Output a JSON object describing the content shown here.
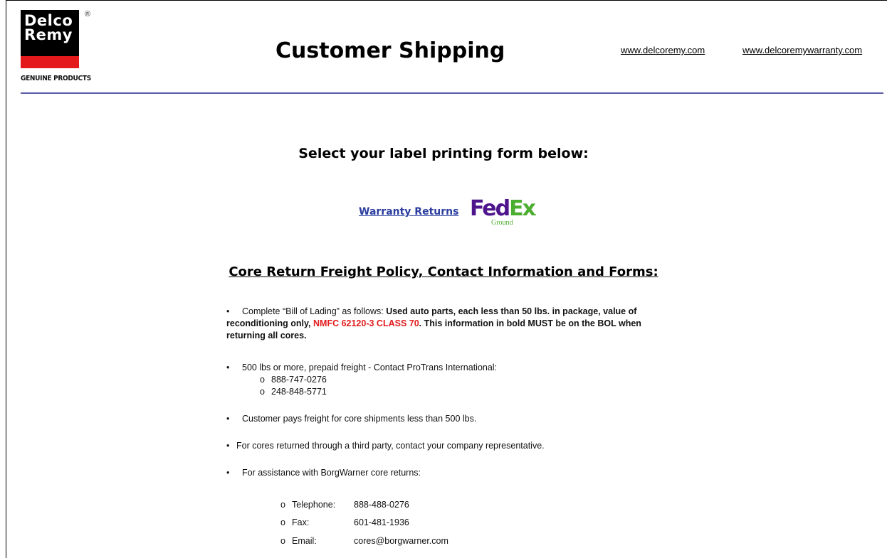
{
  "brand": {
    "line1": "Delco",
    "line2": "Remy",
    "registered": "®",
    "tagline": "GENUINE PRODUCTS"
  },
  "header": {
    "title": "Customer Shipping",
    "links": [
      "www.delcoremy.com",
      "www.delcoremywarranty.com"
    ]
  },
  "select_title": "Select your label printing form below:",
  "warranty_link": "Warranty Returns",
  "fedex": {
    "fed": "Fed",
    "ex": "Ex",
    "dot": ".",
    "ground": "Ground"
  },
  "policy_title": "Core Return Freight Policy, Contact Information and Forms:",
  "policy": {
    "bol": {
      "bullet": "•",
      "intro": "Complete “Bill of Lading” as follows: ",
      "bold1": "Used auto parts, each less than 50 lbs. in package, value of reconditioning only, ",
      "red": "NMFC 62120-3 CLASS 70",
      "bold2": ". This information in bold MUST be on the BOL when returning all cores."
    },
    "freight": "500 lbs or more, prepaid freight - Contact ProTrans International:",
    "freight_phones": [
      "888-747-0276",
      "248-848-5771"
    ],
    "customer_pays": "Customer pays freight for core shipments less than 500 lbs.",
    "third_party": "For cores returned through a third party, contact your company representative.",
    "assistance": "For assistance with BorgWarner core returns:",
    "contacts": [
      {
        "label": "Telephone:",
        "value": "888-488-0276"
      },
      {
        "label": "Fax:",
        "value": "601-481-1936"
      },
      {
        "label": "Email:",
        "value": "cores@borgwarner.com"
      }
    ],
    "sub_marker": "o"
  }
}
